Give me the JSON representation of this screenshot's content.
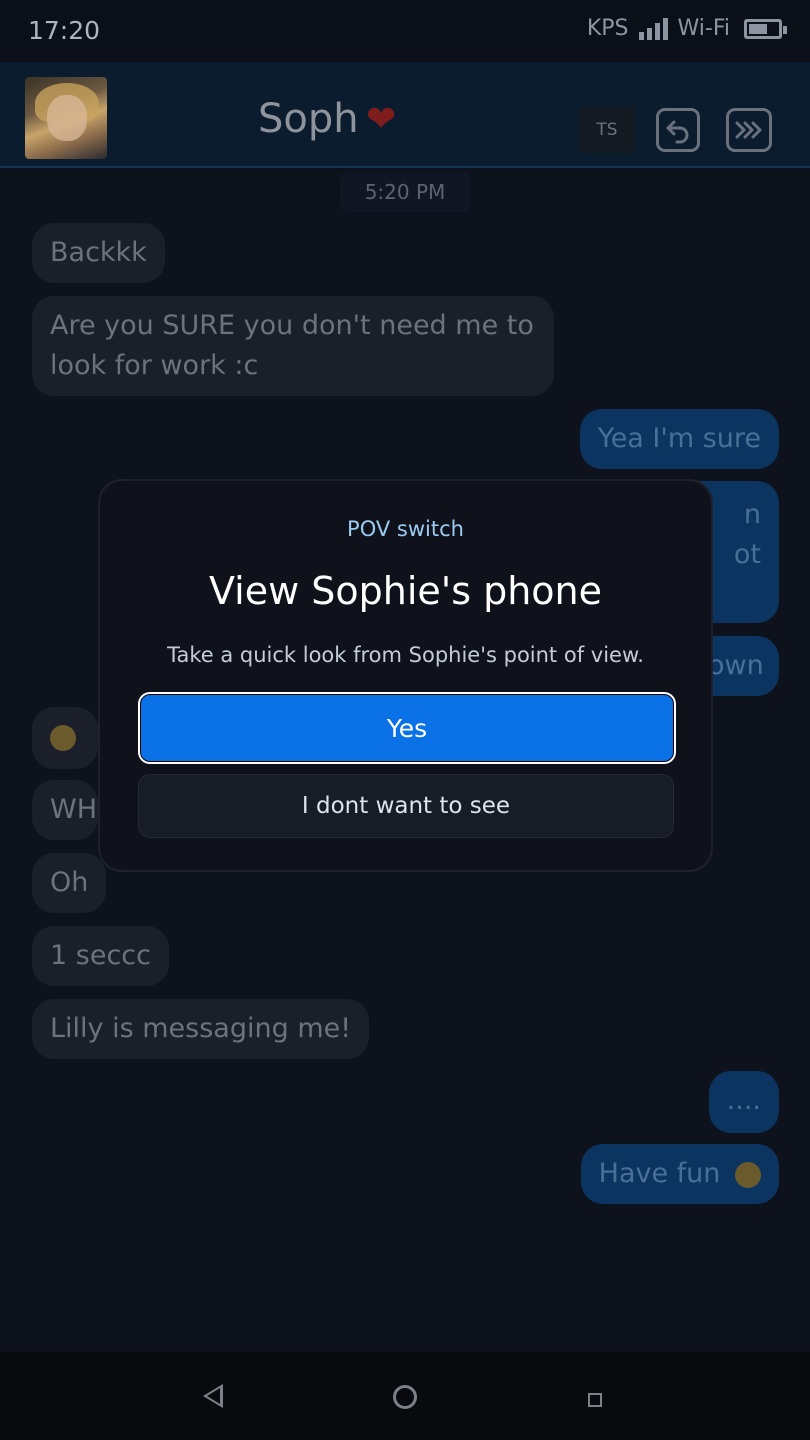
{
  "status_bar": {
    "time": "17:20",
    "carrier": "KPS",
    "wifi": "Wi-Fi",
    "battery_level": 0.6
  },
  "header": {
    "contact_name": "Soph",
    "ts_label": "TS"
  },
  "chat": {
    "timestamp": "5:20 PM",
    "messages": [
      {
        "dir": "in",
        "text": "Backkk"
      },
      {
        "dir": "in",
        "text": "Are you SURE you don't need me to look for work :c"
      },
      {
        "dir": "out",
        "text": "Yea I'm sure"
      },
      {
        "dir": "out",
        "text": "n"
      },
      {
        "dir": "out",
        "text": "ot"
      },
      {
        "dir": "out",
        "text": "own"
      },
      {
        "dir": "in",
        "text": "WH"
      },
      {
        "dir": "in",
        "text": "Oh"
      },
      {
        "dir": "in",
        "text": "1 seccc"
      },
      {
        "dir": "in",
        "text": "Lilly is messaging me!"
      },
      {
        "dir": "out",
        "text": "...."
      },
      {
        "dir": "out",
        "text": "Have fun"
      }
    ]
  },
  "dialog": {
    "eyebrow": "POV switch",
    "title": "View Sophie's phone",
    "description": "Take a quick look from Sophie's point of view.",
    "confirm_label": "Yes",
    "decline_label": "I dont want to see"
  },
  "colors": {
    "accent": "#0a72e6",
    "dialog_bg": "#0f121b",
    "eyebrow": "#9ccbf2"
  }
}
